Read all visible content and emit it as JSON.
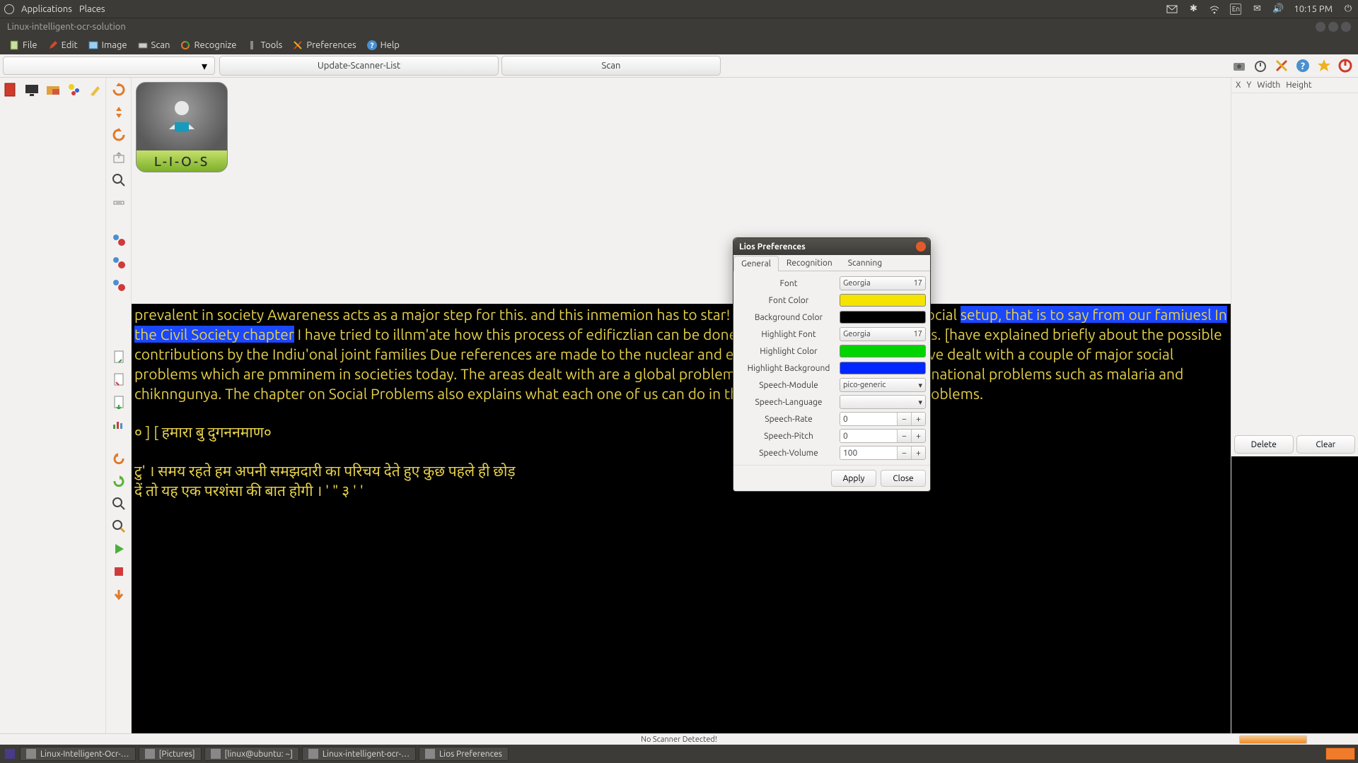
{
  "gnome": {
    "apps": "Applications",
    "places": "Places",
    "lang": "En",
    "time": "10:15 PM"
  },
  "window": {
    "title": "Linux-intelligent-ocr-solution"
  },
  "menubar": {
    "file": "File",
    "edit": "Edit",
    "image": "Image",
    "scan": "Scan",
    "recognize": "Recognize",
    "tools": "Tools",
    "preferences": "Preferences",
    "help": "Help"
  },
  "actions": {
    "update": "Update-Scanner-List",
    "scan": "Scan"
  },
  "logo": {
    "label": "L-I-O-S"
  },
  "coords": {
    "x": "X",
    "y": "Y",
    "w": "Width",
    "h": "Height"
  },
  "right_buttons": {
    "delete": "Delete",
    "clear": "Clear"
  },
  "status": "No Scanner Detected!",
  "text": {
    "p1a": "prevalent in society Awareness acts as a major step for this. and this inmemion has to star! from the gonad level of our social ",
    "sel": "setup, that is to say from our famiuesl In the Civil Society chapter",
    "p1b": " I have tried to illnm'ate how this process of edificzlian can be done in our respective family whips. [have explained briefly about the possible contributions by the Indiu'onal joint families Due references are made to the nuclear and extende families also. Also I have dealt with a couple of major social problems which are pmminem in societies today. The areas dealt with are a global problems such as global warming and national problems such as malaria and chiknngunya. The chapter on Social Problems also explains what each one of us can do in the fight against these sccial problems.",
    "p2": "० ] [ हमारा बु दुगननमाण०",
    "p3": "टु'  । समय रहते हम अपनी समझदारी का परिचय देते हुए कुछ पहले ही छोड़",
    "p4": "दें तो यह एक परशंसा की बात होगी । ' \" ३ ' '"
  },
  "prefs": {
    "title": "Lios Preferences",
    "tabs": {
      "general": "General",
      "recognition": "Recognition",
      "scanning": "Scanning"
    },
    "labels": {
      "font": "Font",
      "font_color": "Font Color",
      "bg": "Background Color",
      "hfont": "Highlight Font",
      "hcolor": "Highlight Color",
      "hbg": "Highlight Background",
      "smod": "Speech-Module",
      "slang": "Speech-Language",
      "srate": "Speech-Rate",
      "spitch": "Speech-Pitch",
      "svol": "Speech-Volume"
    },
    "values": {
      "font_name": "Georgia",
      "font_size": "17",
      "hfont_name": "Georgia",
      "hfont_size": "17",
      "smod": "pico-generic",
      "slang": "",
      "srate": "0",
      "spitch": "0",
      "svol": "100"
    },
    "colors": {
      "font": "#f4e400",
      "bg": "#000000",
      "hcolor": "#00d400",
      "hbg": "#0026ff"
    },
    "buttons": {
      "apply": "Apply",
      "close": "Close"
    }
  },
  "taskbar": {
    "items": [
      "Linux-Intelligent-Ocr-…",
      "[Pictures]",
      "[linux@ubuntu: ~]",
      "Linux-intelligent-ocr-…",
      "Lios Preferences"
    ]
  }
}
